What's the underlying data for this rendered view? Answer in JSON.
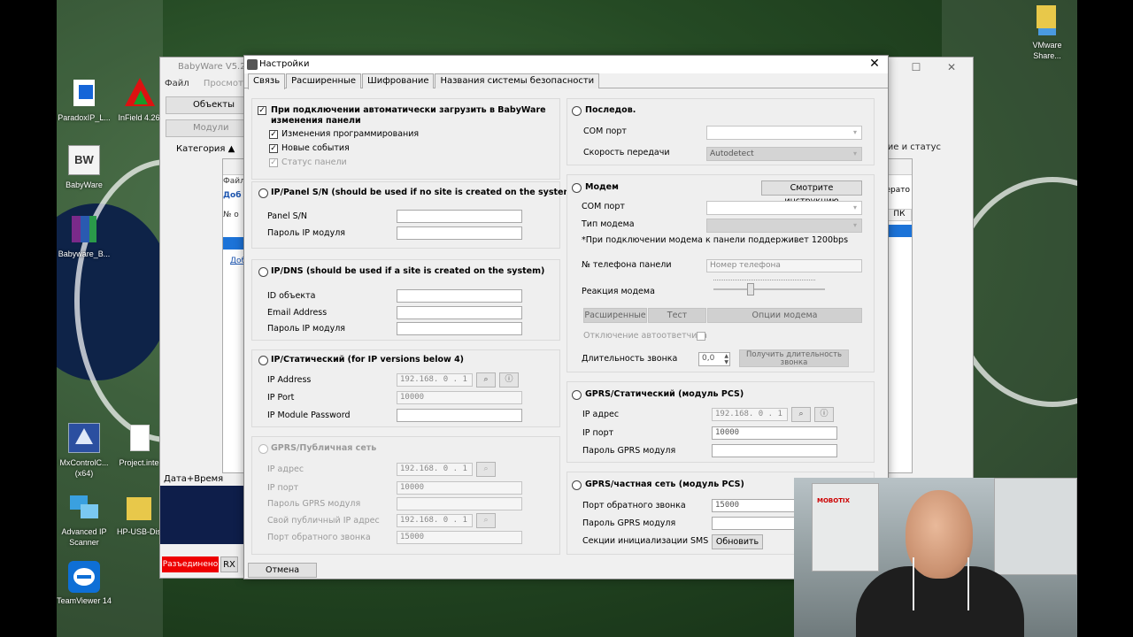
{
  "desktop_icons": {
    "paradox": "ParadoxIP_L...",
    "infield": "InField 4.26",
    "babyware": "BabyWare",
    "babyware_b": "Babyware_B...",
    "mxcontrol": "MxControlC... (x64)",
    "project": "Project.inte",
    "advanced_ip": "Advanced IP Scanner",
    "hp_usb": "HP-USB-Dis",
    "teamviewer": "TeamViewer 14",
    "vmware": "VMware Share..."
  },
  "babyware_window": {
    "title": "BabyWare V5.2.5",
    "menu": [
      "Файл",
      "Просмотр"
    ],
    "toolbar_objects": "Объекты",
    "toolbar_modules": "Модули",
    "category": "Категория",
    "right_header": "ение и статус",
    "date_time": "Дата+Время",
    "disconnected": "Разъединено",
    "rx": "RX",
    "sub_file": "Файл",
    "sub_dob": "Доб",
    "sub_no": "№ о",
    "sub_add": "Доб",
    "sub_right_pk": "ПК",
    "sub_right_oper": "ерато"
  },
  "dialog": {
    "title": "Настройки",
    "tabs": [
      "Связь",
      "Расширенные",
      "Шифрование",
      "Названия системы безопасности"
    ],
    "auto_load": {
      "label": "При подключении автоматически загрузить в BabyWare изменения панели",
      "line2": "панели",
      "items": [
        "Изменения программирования",
        "Новые события",
        "Статус панели"
      ]
    },
    "ip_panel_sn": {
      "heading": "IP/Panel S/N (should be used if no site is created on the system)",
      "panel_sn": "Panel S/N",
      "ip_pass": "Пароль IP модуля"
    },
    "ip_dns": {
      "heading": "IP/DNS (should be used if a site is created on the system)",
      "object_id": "ID объекта",
      "email": "Email Address",
      "ip_pass": "Пароль IP модуля"
    },
    "ip_static": {
      "heading": "IP/Статический (for IP versions below 4)",
      "ip_address": "IP Address",
      "ip_address_val": "192.168. 0 . 1",
      "ip_port": "IP Port",
      "ip_port_val": "10000",
      "password": "IP Module Password"
    },
    "gprs_public": {
      "heading": "GPRS/Публичная сеть",
      "ip": "IP адрес",
      "ip_val": "192.168. 0 . 1",
      "port": "IP порт",
      "port_val": "10000",
      "gprs_pass": "Пароль GPRS модуля",
      "own_ip": "Свой публичный IP адрес",
      "own_ip_val": "192.168. 0 . 1",
      "callback_port": "Порт обратного звонка",
      "callback_val": "15000"
    },
    "serial": {
      "heading": "Последов.",
      "com": "COM порт",
      "speed": "Скорость передачи",
      "speed_val": "Autodetect"
    },
    "modem": {
      "heading": "Модем",
      "instructions_btn": "Смотрите инструкцию",
      "com": "COM порт",
      "type": "Тип модема",
      "note": "*При подключении модема к панели поддерживет 1200bps",
      "phone": "№ телефона панели",
      "phone_placeholder": "Номер телефона",
      "reaction": "Реакция модема",
      "btn_ext": "Расширенные",
      "btn_test": "Тест",
      "btn_options": "Опции модема",
      "auto_answer": "Отключение автоответчика",
      "ring_duration": "Длительность звонка",
      "ring_val": "0,0",
      "get_duration": "Получить длительность звонка"
    },
    "gprs_static": {
      "heading": "GPRS/Статический (модуль PCS)",
      "ip": "IP адрес",
      "ip_val": "192.168. 0 . 1",
      "port": "IP порт",
      "port_val": "10000",
      "gprs_pass": "Пароль GPRS модуля"
    },
    "gprs_private": {
      "heading": "GPRS/частная сеть (модуль PCS)",
      "callback": "Порт обратного звонка",
      "callback_val": "15000",
      "gprs_pass": "Пароль GPRS модуля",
      "sms": "Секции инициализации SMS",
      "update": "Обновить"
    },
    "cancel": "Отмена"
  },
  "webcam": {
    "poster_text": "MOBOTIX"
  }
}
